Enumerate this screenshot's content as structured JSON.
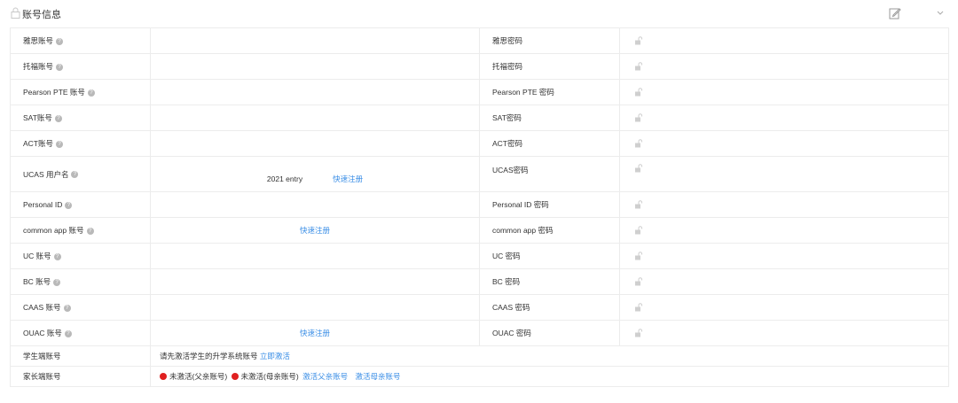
{
  "header": {
    "title": "账号信息"
  },
  "rows": [
    {
      "left_label": "雅思账号",
      "right_label": "雅思密码"
    },
    {
      "left_label": "托福账号",
      "right_label": "托福密码"
    },
    {
      "left_label": "Pearson PTE 账号",
      "right_label": "Pearson PTE 密码"
    },
    {
      "left_label": "SAT账号",
      "right_label": "SAT密码"
    },
    {
      "left_label": "ACT账号",
      "right_label": "ACT密码"
    },
    {
      "left_label": "UCAS 用户名",
      "value": "2021 entry",
      "link": "快速注册",
      "right_label": "UCAS密码"
    },
    {
      "left_label": "Personal ID",
      "right_label": "Personal ID 密码"
    },
    {
      "left_label": "common app 账号",
      "link": "快速注册",
      "right_label": "common app 密码"
    },
    {
      "left_label": "UC 账号",
      "right_label": "UC 密码"
    },
    {
      "left_label": "BC 账号",
      "right_label": "BC 密码"
    },
    {
      "left_label": "CAAS 账号",
      "right_label": "CAAS 密码"
    },
    {
      "left_label": "OUAC 账号",
      "link": "快速注册",
      "right_label": "OUAC 密码"
    }
  ],
  "student": {
    "label": "学生端账号",
    "text": "请先激活学生的升学系统账号",
    "link": "立即激活"
  },
  "parent": {
    "label": "家长端账号",
    "father_status": "未激活(父亲账号)",
    "mother_status": "未激活(母亲账号)",
    "father_link": "激活父亲账号",
    "mother_link": "激活母亲账号"
  },
  "colors": {
    "link": "#3a8ee6",
    "inactive_dot": "#e02020",
    "border": "#ececec"
  },
  "icons": [
    "lock-icon",
    "edit-icon",
    "chevron-down-icon",
    "help-icon",
    "unlock-icon"
  ]
}
